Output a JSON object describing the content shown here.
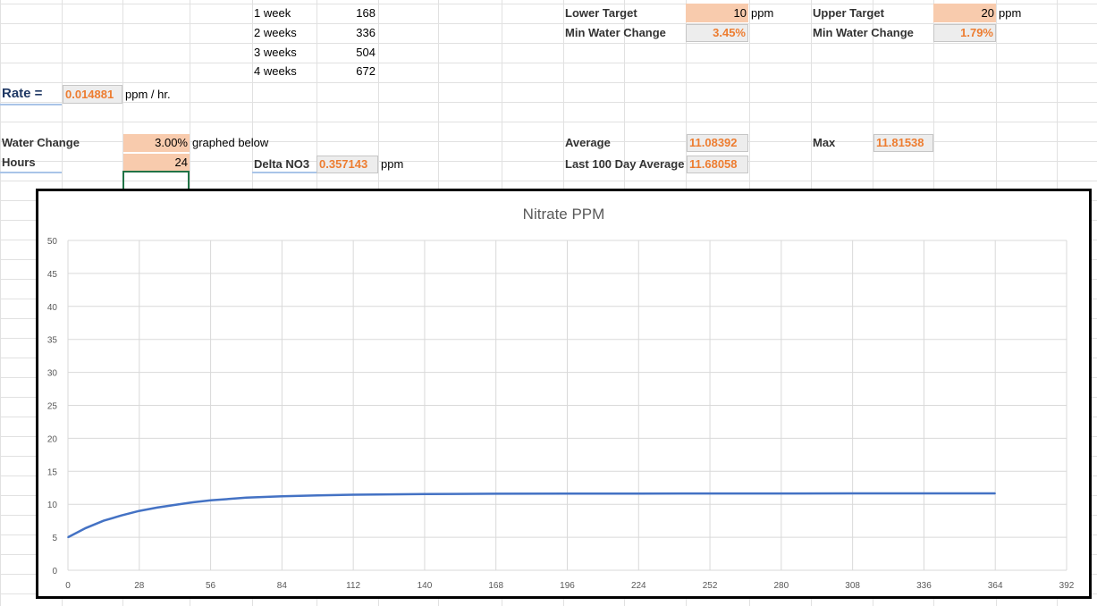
{
  "weeks": [
    {
      "label": "1 week",
      "hours": "168"
    },
    {
      "label": "2 weeks",
      "hours": "336"
    },
    {
      "label": "3 weeks",
      "hours": "504"
    },
    {
      "label": "4 weeks",
      "hours": "672"
    }
  ],
  "rate": {
    "label": "Rate =",
    "value": "0.014881",
    "unit": "ppm / hr."
  },
  "water_change": {
    "label": "Water Change",
    "value": "3.00%",
    "note": "graphed below"
  },
  "hours": {
    "label": "Hours",
    "value": "24"
  },
  "delta": {
    "label": "Delta NO3",
    "value": "0.357143",
    "unit": "ppm"
  },
  "lower_target": {
    "label": "Lower Target",
    "value": "10",
    "unit": "ppm",
    "min_label": "Min Water Change",
    "min_value": "3.45%"
  },
  "upper_target": {
    "label": "Upper Target",
    "value": "20",
    "unit": "ppm",
    "min_label": "Min Water Change",
    "min_value": "1.79%"
  },
  "stats": {
    "average_label": "Average",
    "average_value": "11.08392",
    "last100_label": "Last 100 Day Average",
    "last100_value": "11.68058",
    "max_label": "Max",
    "max_value": "11.81538"
  },
  "colors": {
    "accent": "#ed7d31",
    "series": "#4472c4",
    "input_fill": "#f8cbad"
  },
  "chart_data": {
    "type": "line",
    "title": "Nitrate PPM",
    "xlabel": "",
    "ylabel": "",
    "xlim": [
      0,
      392
    ],
    "ylim": [
      0,
      50
    ],
    "x_ticks": [
      0,
      28,
      56,
      84,
      112,
      140,
      168,
      196,
      224,
      252,
      280,
      308,
      336,
      364,
      392
    ],
    "y_ticks": [
      0,
      5,
      10,
      15,
      20,
      25,
      30,
      35,
      40,
      45,
      50
    ],
    "grid": true,
    "series": [
      {
        "x": [
          0,
          7,
          14,
          21,
          28,
          35,
          42,
          49,
          56,
          70,
          84,
          98,
          112,
          140,
          168,
          196,
          224,
          252,
          280,
          308,
          336,
          364
        ],
        "values": [
          5.0,
          6.4,
          7.5,
          8.3,
          9.0,
          9.5,
          9.9,
          10.3,
          10.6,
          11.0,
          11.2,
          11.35,
          11.45,
          11.55,
          11.6,
          11.62,
          11.63,
          11.64,
          11.64,
          11.65,
          11.65,
          11.65
        ]
      }
    ]
  }
}
